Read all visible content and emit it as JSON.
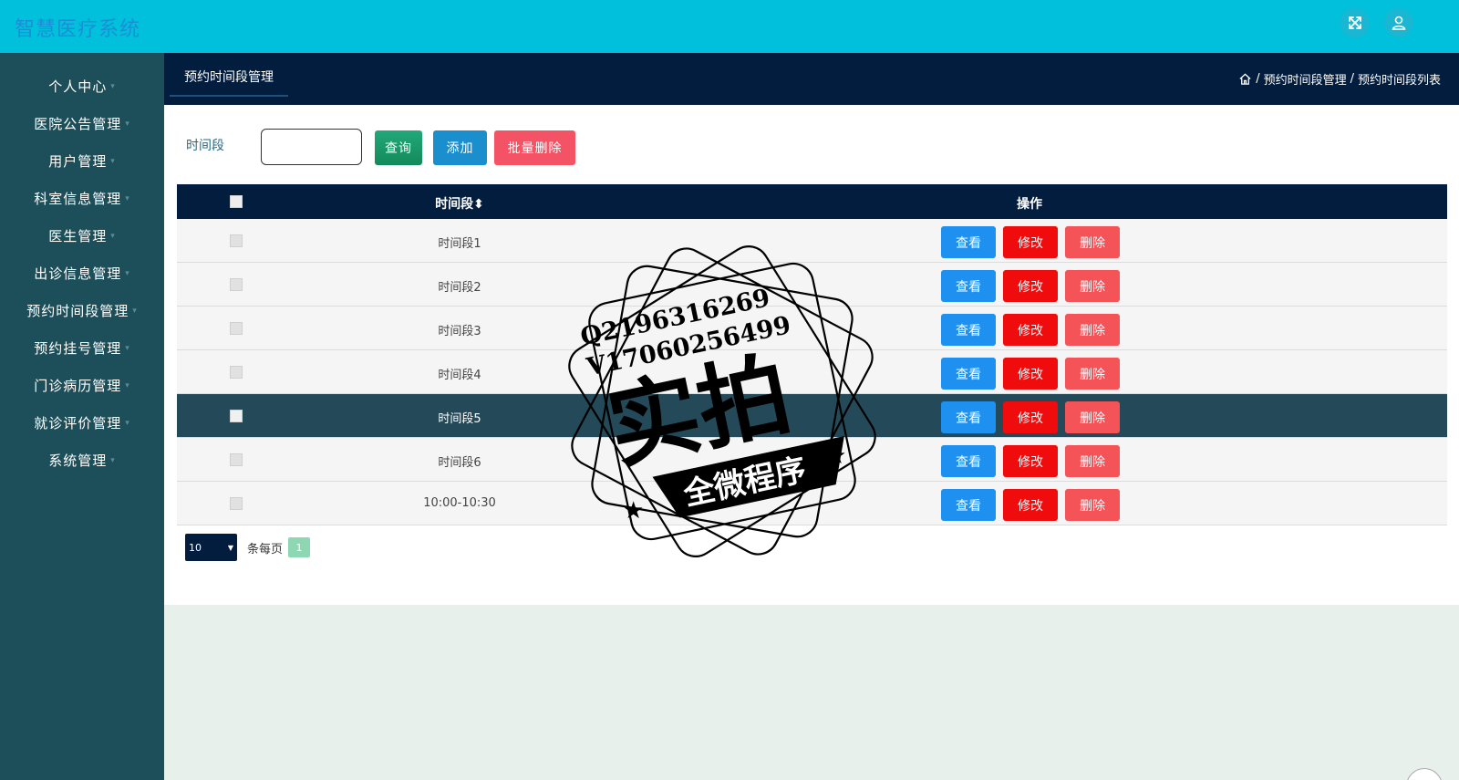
{
  "app": {
    "title": "智慧医疗系统"
  },
  "sidebar": {
    "items": [
      {
        "label": "个人中心"
      },
      {
        "label": "医院公告管理"
      },
      {
        "label": "用户管理"
      },
      {
        "label": "科室信息管理"
      },
      {
        "label": "医生管理"
      },
      {
        "label": "出诊信息管理"
      },
      {
        "label": "预约时间段管理"
      },
      {
        "label": "预约挂号管理"
      },
      {
        "label": "门诊病历管理"
      },
      {
        "label": "就诊评价管理"
      },
      {
        "label": "系统管理"
      }
    ]
  },
  "header": {
    "tab": "预约时间段管理",
    "breadcrumb": [
      "预约时间段管理",
      "预约时间段列表"
    ]
  },
  "search": {
    "label": "时间段",
    "value": "",
    "query_label": "查询",
    "add_label": "添加",
    "batch_delete_label": "批量删除"
  },
  "table": {
    "headers": {
      "time": "时间段",
      "sort_icon": "sort-icon",
      "operation": "操作"
    },
    "rows": [
      {
        "time": "时间段1"
      },
      {
        "time": "时间段2"
      },
      {
        "time": "时间段3"
      },
      {
        "time": "时间段4"
      },
      {
        "time": "时间段5",
        "highlighted": true
      },
      {
        "time": "时间段6"
      },
      {
        "time": "10:00-10:30"
      }
    ],
    "actions": {
      "view": "查看",
      "edit": "修改",
      "delete": "删除"
    }
  },
  "pagination": {
    "page_size": "10",
    "per_page_label": "条每页",
    "current_page": "1"
  },
  "watermark": {
    "line1": "Q2196316269",
    "line2": "V17060256499",
    "main": "实拍",
    "banner": "全微程序"
  },
  "colors": {
    "topbar": "#00c0dc",
    "sidebar": "#1d4f5b",
    "header": "#021d3d",
    "view_button": "#1e90ef",
    "edit_button": "#f00c0c",
    "delete_button": "#f45358"
  }
}
